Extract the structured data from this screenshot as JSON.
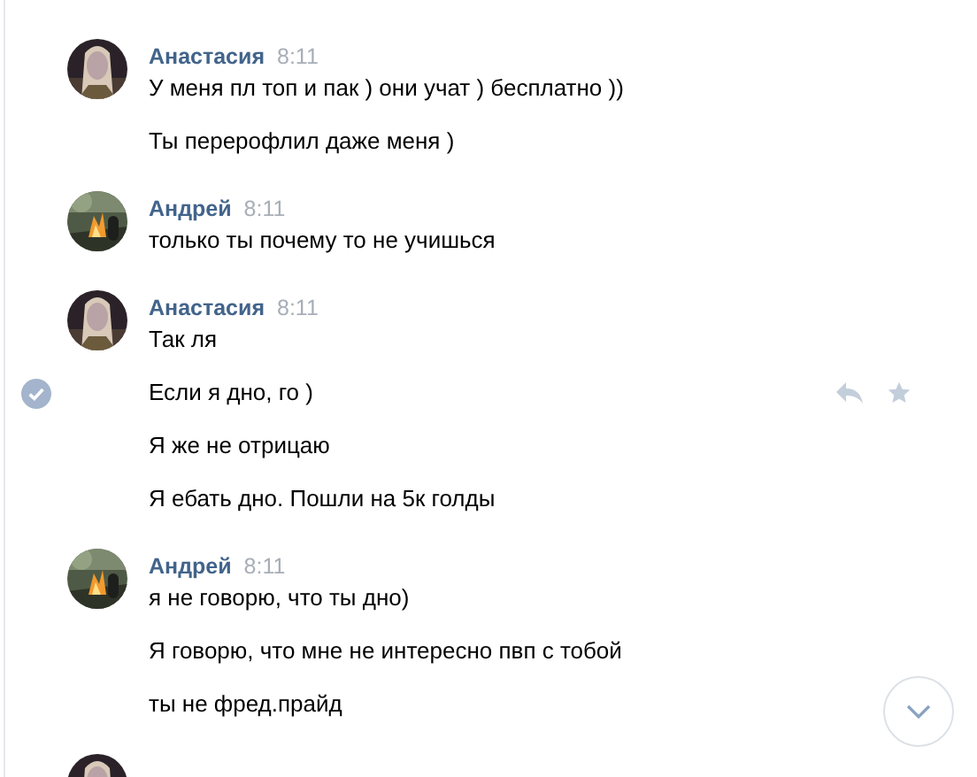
{
  "groups": [
    {
      "author": "Анастасия",
      "time": "8:11",
      "avatar": {
        "kind": "picture"
      },
      "messages": [
        {
          "text": "У меня пл топ и пак ) они учат ) бесплатно ))",
          "selected": false
        },
        {
          "text": "Ты перерофлил даже меня )",
          "selected": false
        }
      ]
    },
    {
      "author": "Андрей",
      "time": "8:11",
      "avatar": {
        "kind": "picture"
      },
      "messages": [
        {
          "text": "только ты почему то не учишься",
          "selected": false
        }
      ]
    },
    {
      "author": "Анастасия",
      "time": "8:11",
      "avatar": {
        "kind": "picture"
      },
      "messages": [
        {
          "text": "Так ля",
          "selected": false
        },
        {
          "text": "Если я дно, го )",
          "selected": true
        },
        {
          "text": "Я же не отрицаю",
          "selected": false
        },
        {
          "text": "Я ебать дно. Пошли на 5к голды",
          "selected": false
        }
      ]
    },
    {
      "author": "Андрей",
      "time": "8:11",
      "avatar": {
        "kind": "picture"
      },
      "messages": [
        {
          "text": "я не говорю, что ты дно)",
          "selected": false
        },
        {
          "text": "Я говорю, что мне не интересно пвп с тобой",
          "selected": false
        },
        {
          "text": "ты не фред.прайд",
          "selected": false
        }
      ]
    },
    {
      "avatar": {
        "kind": "picture"
      }
    }
  ]
}
